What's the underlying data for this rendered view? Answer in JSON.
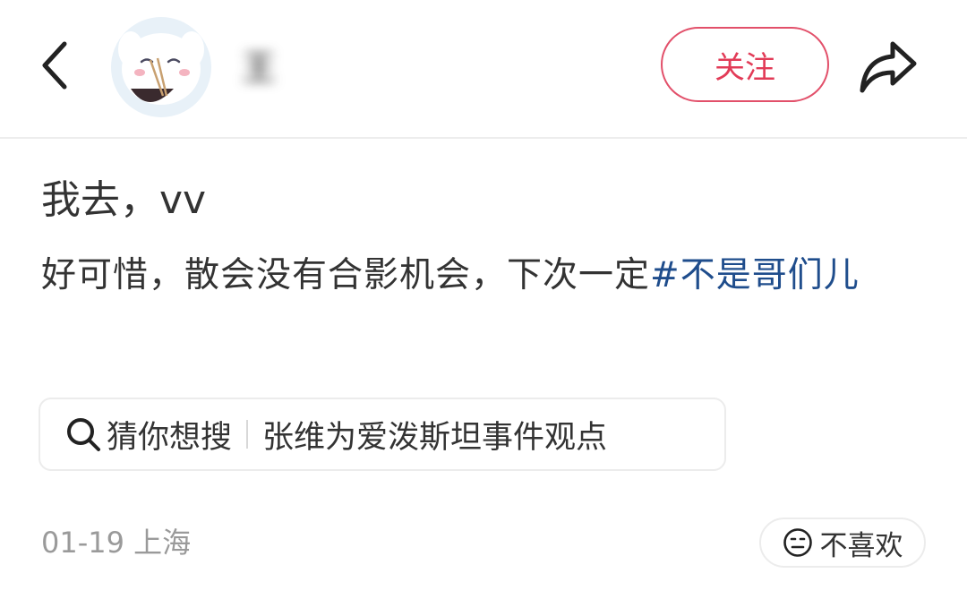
{
  "header": {
    "username": "王",
    "follow_label": "关注"
  },
  "post": {
    "title": "我去，vv",
    "body_text": "好可惜，散会没有合影机会，下次一定",
    "hashtag": "#不是哥们儿"
  },
  "suggestion": {
    "label": "猜你想搜",
    "query": "张维为爱泼斯坦事件观点"
  },
  "meta": {
    "date": "01-19",
    "location": "上海"
  },
  "actions": {
    "dislike_label": "不喜欢"
  },
  "colors": {
    "follow_accent": "#e23b57",
    "hashtag": "#1f4d8c",
    "meta_text": "#9a9a9a"
  },
  "icons": {
    "back": "chevron-left-icon",
    "share": "share-arrow-icon",
    "search": "search-icon",
    "dislike": "neutral-face-icon"
  }
}
